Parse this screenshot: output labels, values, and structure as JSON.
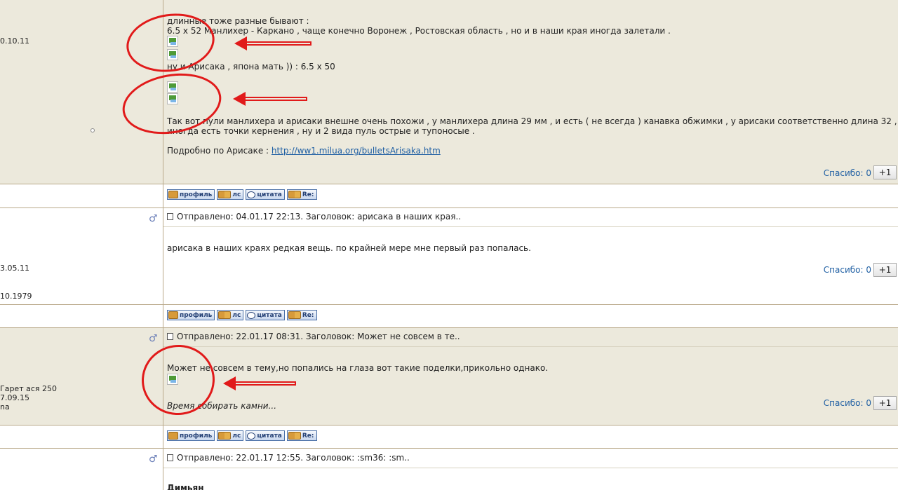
{
  "post1": {
    "left": {
      "date": "0.10.11"
    },
    "lines": [
      "длинные тоже разные бывают :",
      "6.5 x 52 Манлихер - Каркано , чаще конечно Воронеж , Ростовская область , но и в наши края иногда залетали .",
      "ну и Арисака , япона мать )) : 6.5 x 50",
      "Так вот пули манлихера и арисаки внешне очень похожи , у манлихера длина 29 мм , и есть ( не всегда ) канавка обжимки , у арисаки соответственно длина 32 ,",
      "иногда есть точки кернения , ну и 2 вида пуль острые и тупоносые ."
    ],
    "link_label": "Подробно по Арисаке : ",
    "link_url": "http://ww1.milua.org/bulletsArisaka.htm",
    "thanks": "Спасибо: 0",
    "plus": "+1"
  },
  "buttons": {
    "profile": "профиль",
    "pm": "лс",
    "quote": "цитата",
    "reply": "Re:"
  },
  "post2": {
    "icon": "male-symbol-icon",
    "left": {
      "date1": "3.05.11",
      "date2": "10.1979"
    },
    "header": "Отправлено: 04.01.17 22:13. Заголовок: арисака в наших края..",
    "body": "арисака в наших краях редкая вещь. по крайней мере мне первый раз попалась.",
    "thanks": "Спасибо: 0",
    "plus": "+1"
  },
  "post3": {
    "icon": "male-symbol-icon",
    "left": {
      "line1": "Гарет ася 250",
      "line2": "7.09.15",
      "line3": "na"
    },
    "header": "Отправлено: 22.01.17 08:31. Заголовок: Может не совсем в те..",
    "body": "Может не совсем в тему,но попались на глаза вот такие поделки,прикольно однако.",
    "signature": "Время собирать камни...",
    "thanks": "Спасибо: 0",
    "plus": "+1"
  },
  "post4": {
    "icon": "male-symbol-icon",
    "header": "Отправлено: 22.01.17 12:55. Заголовок:              :sm36: :sm..",
    "body_start": "Димьян"
  },
  "annotation_color": "#e11a1a"
}
